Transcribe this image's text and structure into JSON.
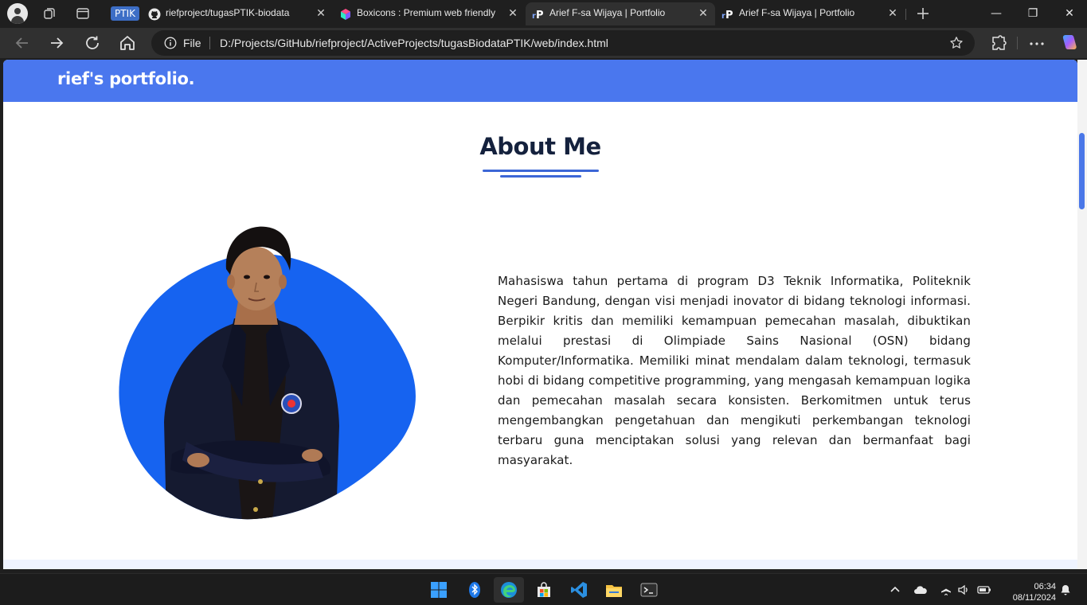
{
  "browser": {
    "tab_group_label": "PTIK",
    "tabs": [
      {
        "title": "riefproject/tugasPTIK-biodata",
        "favicon": "github-icon",
        "active": false
      },
      {
        "title": "Boxicons : Premium web friendly icons",
        "favicon": "boxicons-icon",
        "active": false
      },
      {
        "title": "Arief F-sa Wijaya | Portfolio",
        "favicon": "portfolio-icon",
        "active": true
      },
      {
        "title": "Arief F-sa Wijaya | Portfolio",
        "favicon": "portfolio-icon",
        "active": false
      }
    ],
    "scheme_label": "File",
    "url": "D:/Projects/GitHub/riefproject/ActiveProjects/tugasBiodataPTIK/web/index.html"
  },
  "site": {
    "logo": "rief's portfolio.",
    "accent_color": "#4a77ee",
    "about": {
      "title": "About Me",
      "photo": "portrait-photo",
      "paragraph": "Mahasiswa tahun pertama di program D3 Teknik Informatika, Politeknik Negeri Bandung, dengan visi menjadi inovator di bidang teknologi informasi. Berpikir kritis dan memiliki kemampuan pemecahan masalah, dibuktikan melalui prestasi di Olimpiade Sains Nasional (OSN) bidang Komputer/Informatika. Memiliki minat mendalam dalam teknologi, termasuk hobi di bidang competitive programming, yang mengasah kemampuan logika dan pemecahan masalah secara konsisten. Berkomitmen untuk terus mengembangkan pengetahuan dan mengikuti perkembangan teknologi terbaru guna menciptakan solusi yang relevan dan bermanfaat bagi masyarakat."
    }
  },
  "taskbar": {
    "apps": [
      "windows-start-icon",
      "bluetooth-icon",
      "edge-icon",
      "store-icon",
      "vscode-icon",
      "file-explorer-icon",
      "terminal-icon"
    ],
    "time": "06:34",
    "date": "08/11/2024"
  }
}
